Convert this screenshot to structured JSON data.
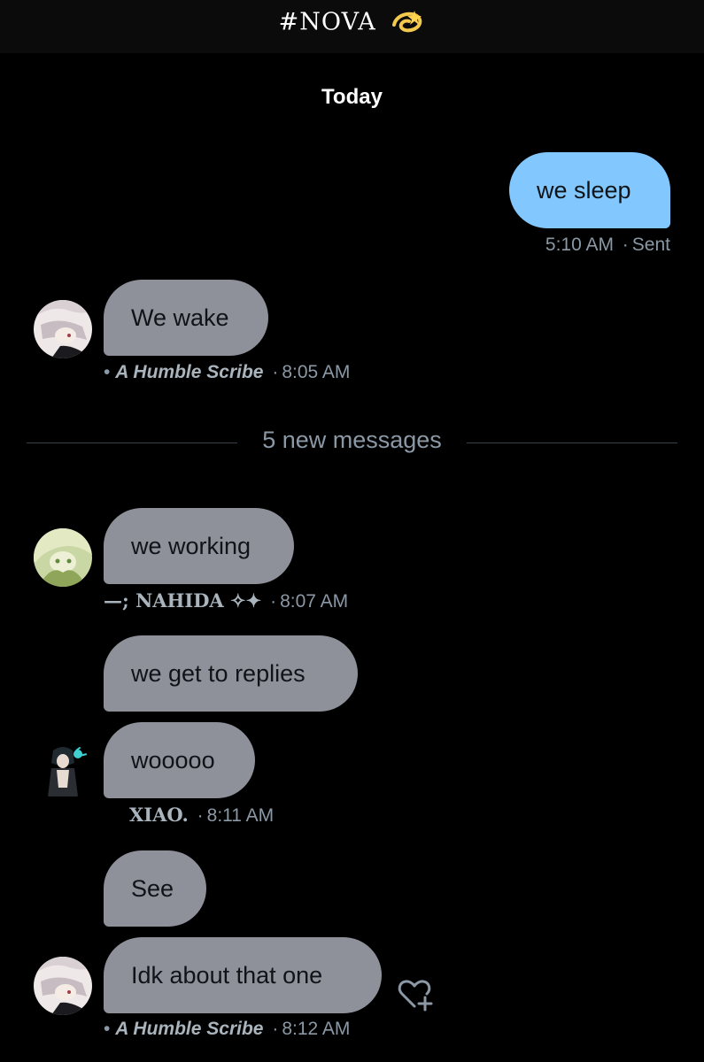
{
  "header": {
    "title": "#NOVA",
    "title_emoji": "dizzy-icon"
  },
  "thread": {
    "day_label": "Today",
    "divider_text": "5 new messages"
  },
  "messages": [
    {
      "direction": "out",
      "text": "we sleep",
      "time": "5:10 AM",
      "status": "Sent"
    },
    {
      "direction": "in",
      "text": "We wake",
      "sender": "A Humble Scribe",
      "sender_prefix": "•",
      "time": "8:05 AM"
    },
    {
      "direction": "in",
      "text": "we working",
      "sender": "—; NAHIDA ✧✦",
      "time": "8:07 AM"
    },
    {
      "direction": "in",
      "text": "we get to replies"
    },
    {
      "direction": "in",
      "text": "wooooo",
      "sender": "XIAO.",
      "time": "8:11 AM"
    },
    {
      "direction": "in",
      "text": "See"
    },
    {
      "direction": "in",
      "text": "Idk about that one",
      "sender": "A Humble Scribe",
      "sender_prefix": "•",
      "time": "8:12 AM"
    }
  ],
  "meta_separator": "·",
  "colors": {
    "background": "#000000",
    "incoming_bubble": "#8e9199",
    "outgoing_bubble": "#83c7ff",
    "meta_text": "#8b98a5"
  }
}
